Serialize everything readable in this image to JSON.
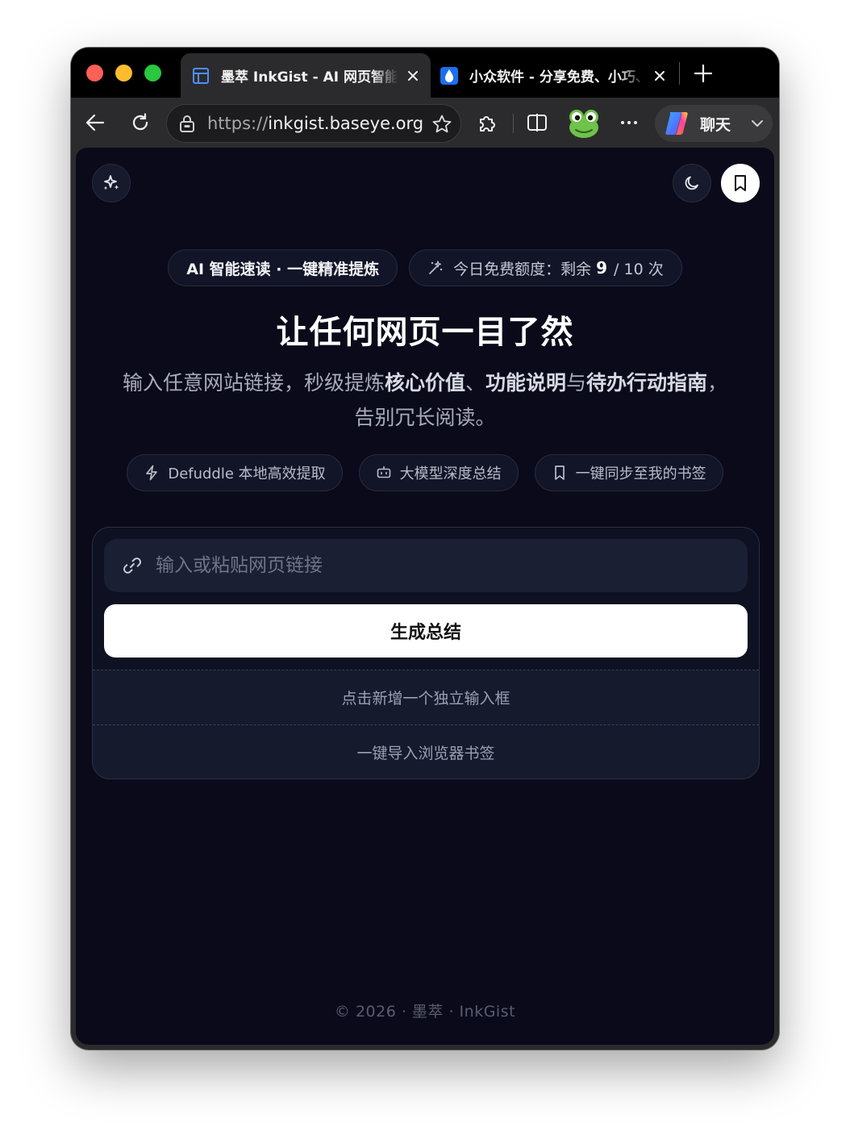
{
  "browser": {
    "tabs": [
      {
        "title": "墨萃 InkGist - AI 网页智能速读",
        "active": true
      },
      {
        "title": "小众软件 - 分享免费、小巧、实用",
        "active": false
      }
    ],
    "url_protocol": "https://",
    "url_host": "inkgist.baseye.org",
    "copilot_label": "聊天"
  },
  "hero": {
    "badge": "AI 智能速读 · 一键精准提炼",
    "quota_label": "今日免费额度：剩余",
    "quota_remaining": "9",
    "quota_total": "/ 10 次",
    "title": "让任何网页一目了然",
    "subtitle_1": "输入任意网站链接，秒级提炼",
    "subtitle_b1": "核心价值",
    "subtitle_2": "、",
    "subtitle_b2": "功能说明",
    "subtitle_3": "与",
    "subtitle_b3": "待办行动指南",
    "subtitle_4": "，告别冗长阅读。"
  },
  "features": [
    {
      "label": "Defuddle 本地高效提取",
      "icon": "bolt-icon"
    },
    {
      "label": "大模型深度总结",
      "icon": "bot-icon"
    },
    {
      "label": "一键同步至我的书签",
      "icon": "bookmark-icon"
    }
  ],
  "form": {
    "placeholder": "输入或粘贴网页链接",
    "submit_label": "生成总结",
    "add_input_label": "点击新增一个独立输入框",
    "import_label": "一键导入浏览器书签"
  },
  "footer": {
    "text": "© 2026 · 墨萃 · InkGist"
  }
}
